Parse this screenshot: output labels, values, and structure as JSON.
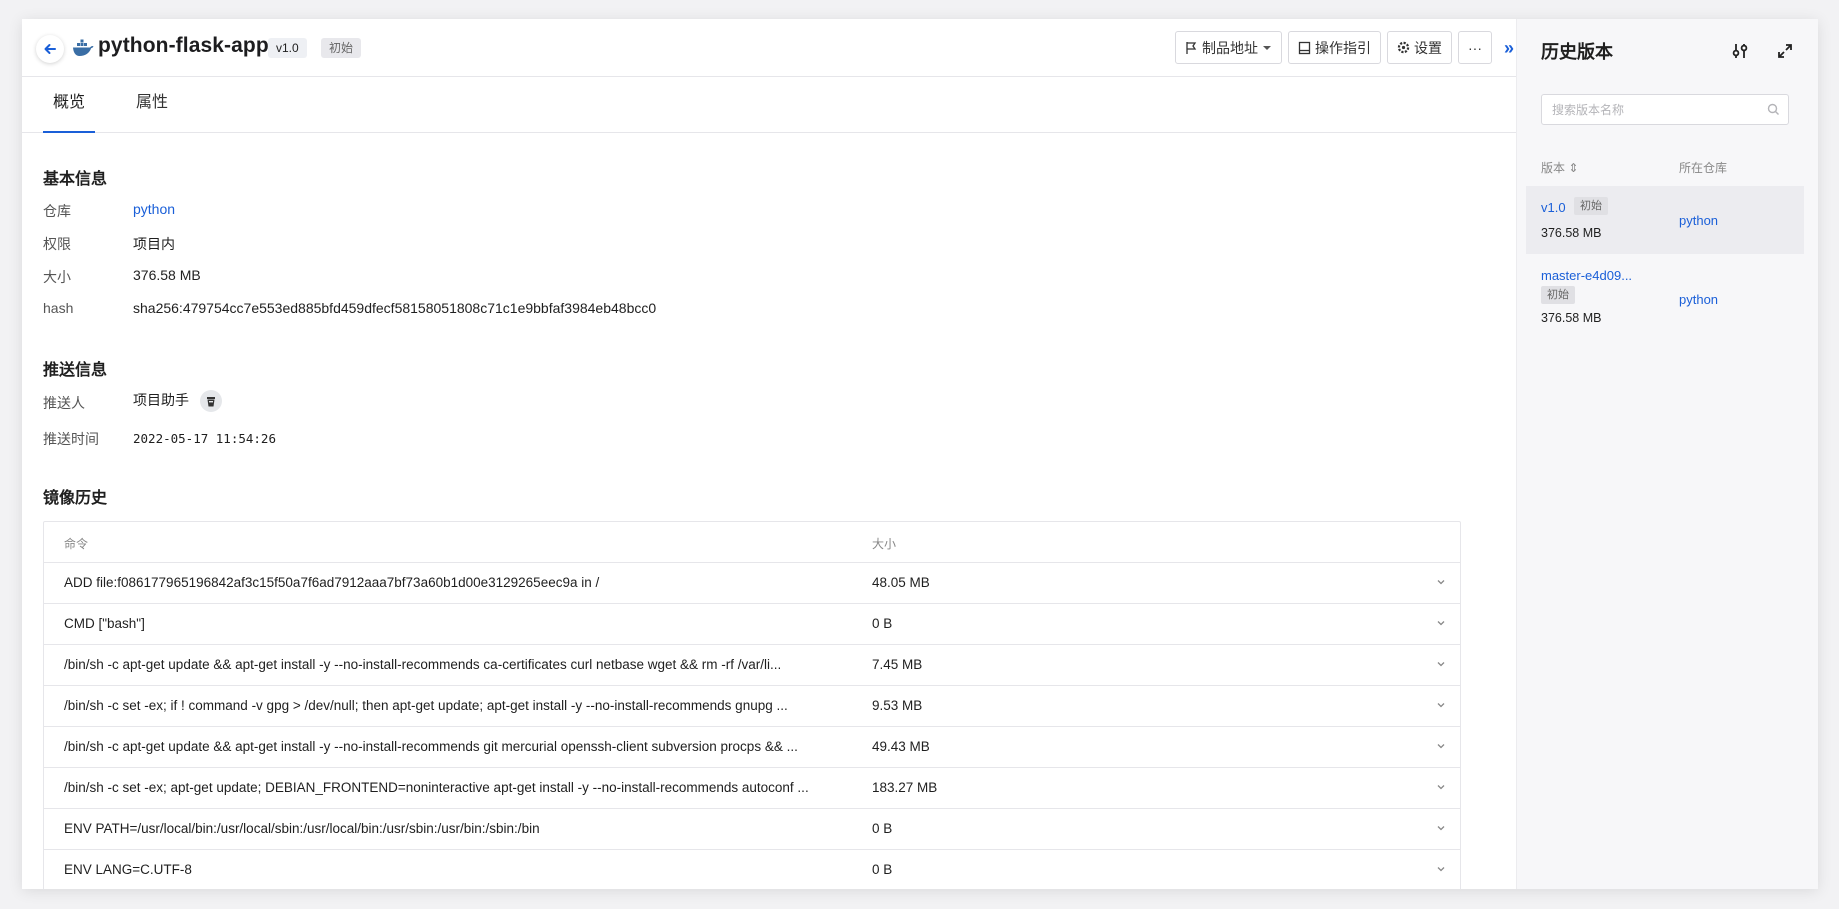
{
  "header": {
    "title": "python-flask-app",
    "version_tag": "v1.0",
    "status_tag": "初始",
    "buttons": {
      "artifact_address": "制品地址",
      "guide": "操作指引",
      "settings": "设置",
      "more": "···"
    },
    "collapse_glyph": "»"
  },
  "tabs": [
    {
      "label": "概览",
      "active": true
    },
    {
      "label": "属性",
      "active": false
    }
  ],
  "basic_info": {
    "title": "基本信息",
    "fields": [
      {
        "label": "仓库",
        "value": "python"
      },
      {
        "label": "权限",
        "value": "项目内"
      },
      {
        "label": "大小",
        "value": "376.58 MB"
      },
      {
        "label": "hash",
        "value": "sha256:479754cc7e553ed885bfd459dfecf58158051808c71c1e9bbfaf3984eb48bcc0"
      }
    ]
  },
  "push_info": {
    "title": "推送信息",
    "pusher_label": "推送人",
    "pusher_value": "项目助手",
    "time_label": "推送时间",
    "time_value": "2022-05-17 11:54:26"
  },
  "history": {
    "title": "镜像历史",
    "col_command": "命令",
    "col_size": "大小",
    "rows": [
      {
        "command": "ADD file:f086177965196842af3c15f50a7f6ad7912aaa7bf73a60b1d00e3129265eec9a in /",
        "size": "48.05 MB"
      },
      {
        "command": "CMD [\"bash\"]",
        "size": "0 B"
      },
      {
        "command": "/bin/sh -c apt-get update && apt-get install -y --no-install-recommends ca-certificates curl netbase wget && rm -rf /var/li...",
        "size": "7.45 MB"
      },
      {
        "command": "/bin/sh -c set -ex; if ! command -v gpg > /dev/null; then apt-get update; apt-get install -y --no-install-recommends gnupg ...",
        "size": "9.53 MB"
      },
      {
        "command": "/bin/sh -c apt-get update && apt-get install -y --no-install-recommends git mercurial openssh-client subversion procps && ...",
        "size": "49.43 MB"
      },
      {
        "command": "/bin/sh -c set -ex; apt-get update; DEBIAN_FRONTEND=noninteractive apt-get install -y --no-install-recommends autoconf ...",
        "size": "183.27 MB"
      },
      {
        "command": "ENV PATH=/usr/local/bin:/usr/local/sbin:/usr/local/bin:/usr/sbin:/usr/bin:/sbin:/bin",
        "size": "0 B"
      },
      {
        "command": "ENV LANG=C.UTF-8",
        "size": "0 B"
      }
    ]
  },
  "side": {
    "title": "历史版本",
    "search_placeholder": "搜索版本名称",
    "col_version": "版本 ⇕",
    "col_repo": "所在仓库",
    "versions": [
      {
        "name": "v1.0",
        "tag": "初始",
        "size": "376.58 MB",
        "repo": "python"
      },
      {
        "name": "master-e4d09...",
        "tag": "初始",
        "size": "376.58 MB",
        "repo": "python"
      }
    ]
  },
  "colors": {
    "accent": "#1a5fd8",
    "border": "#e6e6ea",
    "side_bg": "#f7f7f9"
  }
}
